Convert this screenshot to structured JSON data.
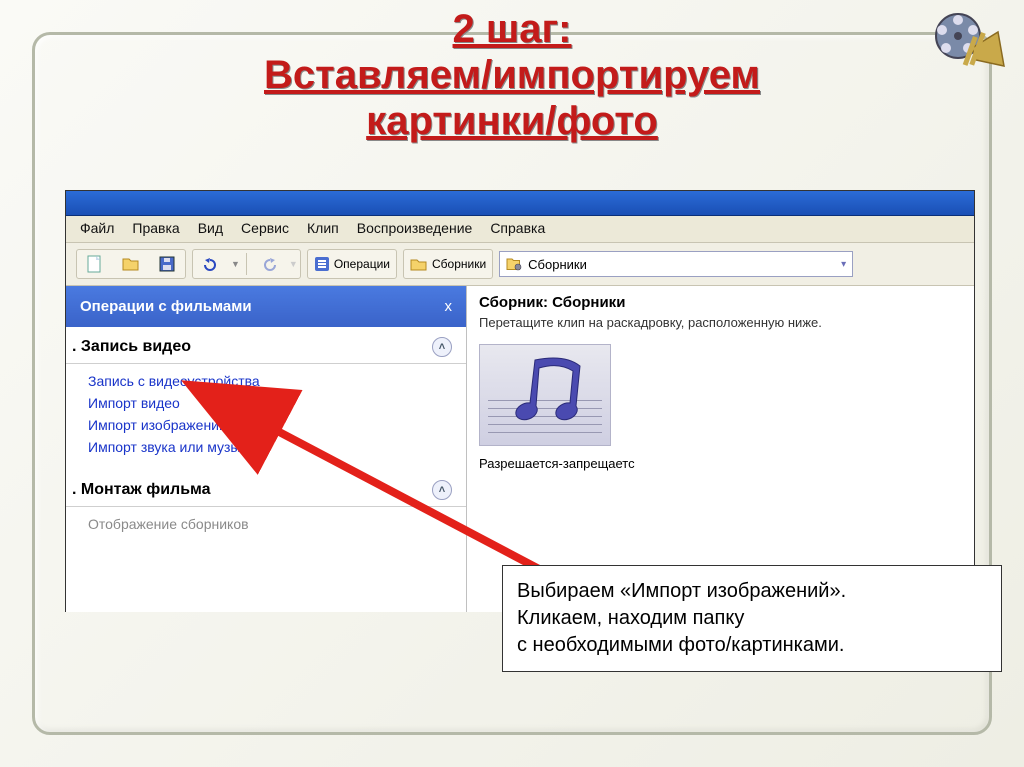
{
  "slide": {
    "title_line1": "2 шаг:",
    "title_line2": "Вставляем/импортируем",
    "title_line3": "картинки/фото"
  },
  "menubar": {
    "file": "Файл",
    "edit": "Правка",
    "view": "Вид",
    "tools": "Сервис",
    "clip": "Клип",
    "play": "Воспроизведение",
    "help": "Справка"
  },
  "toolbar": {
    "operations_label": "Операции",
    "collections_label": "Сборники",
    "combo_selected": "Сборники"
  },
  "task_pane": {
    "header": "Операции с фильмами",
    "close_x": "x",
    "section1_title": "Запись видео",
    "links1": {
      "l1": "Запись с видеоустройства",
      "l2": "Импорт видео",
      "l3": "Импорт изображений",
      "l4": "Импорт звука или музыки"
    },
    "section2_title": "Монтаж фильма",
    "links2": {
      "l1": "Отображение сборников"
    },
    "section1_num": ".",
    "section2_num": "."
  },
  "collection": {
    "title": "Сборник: Сборники",
    "subtitle": "Перетащите клип на раскадровку, расположенную ниже.",
    "item_caption": "Разрешается-запрещаетс"
  },
  "note": {
    "line1": "Выбираем «Импорт изображений».",
    "line2": "Кликаем, находим папку",
    "line3": "с необходимыми фото/картинками."
  }
}
